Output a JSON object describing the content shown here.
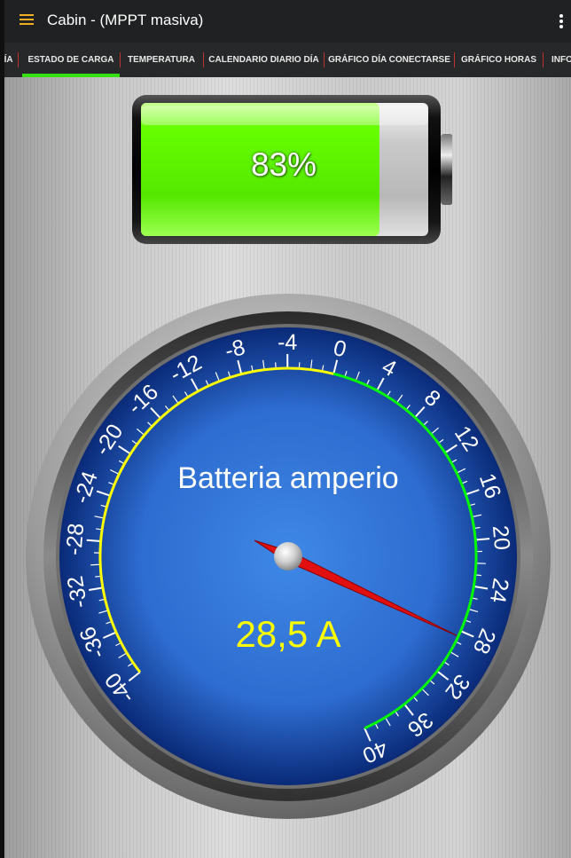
{
  "app": {
    "title": "Cabin - (MPPT masiva)"
  },
  "icons": {
    "menu": "hamburger-menu-icon",
    "overflow": "more-vert-icon"
  },
  "tabs": [
    {
      "label": "DÍA"
    },
    {
      "label": "ESTADO DE CARGA",
      "active": true
    },
    {
      "label": "TEMPERATURA"
    },
    {
      "label": "CALENDARIO DIARIO DÍA"
    },
    {
      "label": "GRÁFICO DÍA CONECTARSE"
    },
    {
      "label": "GRÁFICO HORAS"
    },
    {
      "label": "INFO"
    }
  ],
  "battery": {
    "percent_text": "83%",
    "level": 0.83,
    "fill_color": "#66ff00"
  },
  "gauge": {
    "title": "Batteria amperio",
    "reading_text": "28,5 A",
    "value": 28.5,
    "min": -40,
    "max": 40,
    "tick_labels": [
      "-40",
      "-36",
      "-32",
      "-28",
      "-24",
      "-20",
      "-16",
      "-12",
      "-8",
      "-4",
      "0",
      "4",
      "8",
      "12",
      "16",
      "20",
      "24",
      "28",
      "32",
      "36",
      "40"
    ],
    "negative_arc_color": "#ffff00",
    "positive_arc_color": "#00ff00",
    "reading_color": "#ffff00",
    "needle_color": "#e01010"
  }
}
